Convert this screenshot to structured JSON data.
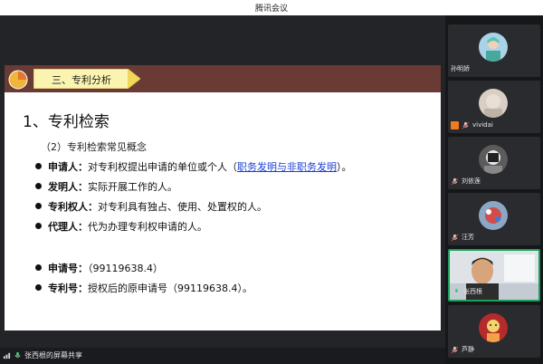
{
  "window": {
    "title": "腾讯会议"
  },
  "slide": {
    "section_label": "三、专利分析",
    "title": "1、专利检索",
    "subtitle": "（2）专利检索常见概念",
    "bullets": [
      {
        "term": "申请人：",
        "text": "对专利权提出申请的单位或个人（",
        "link": "职务发明与非职务发明",
        "tail": "）。"
      },
      {
        "term": "发明人：",
        "text": "实际开展工作的人。"
      },
      {
        "term": "专利权人：",
        "text": "对专利具有独占、使用、处置权的人。"
      },
      {
        "term": "代理人：",
        "text": "代为办理专利权申请的人。"
      },
      {
        "term": "申请号：",
        "text": "（99119638.4）"
      },
      {
        "term": "专利号：",
        "text": "授权后的原申请号（99119638.4）。"
      }
    ]
  },
  "participants": [
    {
      "name": "孙明娇"
    },
    {
      "name": "vividai"
    },
    {
      "name": "刘依莲"
    },
    {
      "name": "汪芳"
    },
    {
      "name": "张西根"
    },
    {
      "name": "芦静"
    }
  ],
  "screen_share": {
    "label": "张西根的屏幕共享"
  },
  "colors": {
    "header": "#6a3a35",
    "active_border": "#1aa25a",
    "link": "#1a3fd6"
  }
}
